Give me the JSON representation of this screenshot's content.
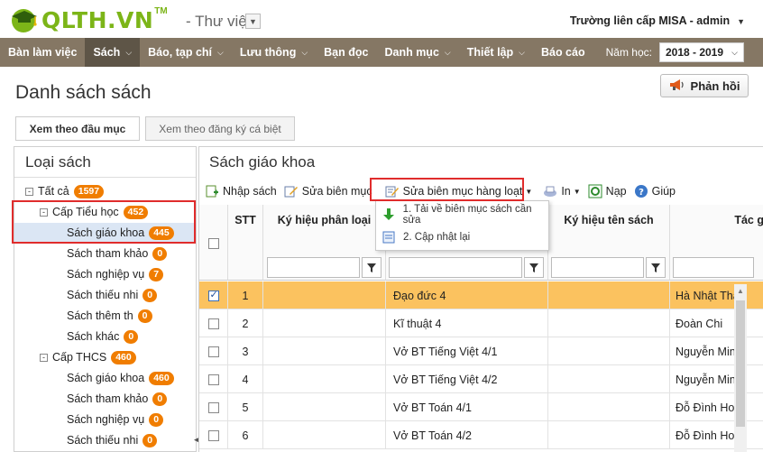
{
  "header": {
    "logo_text": "QLTH.VN",
    "logo_tm": "TM",
    "module": "- Thư viện",
    "school": "Trường liên cấp MISA - admin"
  },
  "nav": {
    "items": [
      {
        "label": "Bàn làm việc",
        "has_chevron": false
      },
      {
        "label": "Sách",
        "has_chevron": true
      },
      {
        "label": "Báo, tạp chí",
        "has_chevron": true
      },
      {
        "label": "Lưu thông",
        "has_chevron": true
      },
      {
        "label": "Bạn đọc",
        "has_chevron": false
      },
      {
        "label": "Danh mục",
        "has_chevron": true
      },
      {
        "label": "Thiết lập",
        "has_chevron": true
      },
      {
        "label": "Báo cáo",
        "has_chevron": false
      }
    ],
    "active_index": 1,
    "year_label": "Năm học:",
    "year_value": "2018 - 2019"
  },
  "page": {
    "title": "Danh sách sách",
    "feedback": "Phản hồi",
    "tab_by_title": "Xem theo đầu mục",
    "tab_by_register": "Xem theo đăng ký cá biệt"
  },
  "left": {
    "title": "Loại sách",
    "tree": [
      {
        "label": "Tất cả",
        "badge": "1597",
        "level": 0,
        "toggle": "-"
      },
      {
        "label": "Cấp Tiểu học",
        "badge": "452",
        "level": 1,
        "toggle": "-"
      },
      {
        "label": "Sách giáo khoa",
        "badge": "445",
        "level": 2,
        "selected": true
      },
      {
        "label": "Sách tham khảo",
        "badge": "0",
        "level": 2
      },
      {
        "label": "Sách nghiệp vụ",
        "badge": "7",
        "level": 2
      },
      {
        "label": "Sách thiếu nhi",
        "badge": "0",
        "level": 2
      },
      {
        "label": "Sách thêm th",
        "badge": "0",
        "level": 2
      },
      {
        "label": "Sách khác",
        "badge": "0",
        "level": 2
      },
      {
        "label": "Cấp THCS",
        "badge": "460",
        "level": 1,
        "toggle": "-"
      },
      {
        "label": "Sách giáo khoa",
        "badge": "460",
        "level": 2
      },
      {
        "label": "Sách tham khảo",
        "badge": "0",
        "level": 2
      },
      {
        "label": "Sách nghiệp vụ",
        "badge": "0",
        "level": 2
      },
      {
        "label": "Sách thiếu nhi",
        "badge": "0",
        "level": 2
      }
    ]
  },
  "right": {
    "title": "Sách giáo khoa",
    "toolbar": {
      "import": "Nhập sách",
      "edit": "Sửa biên mục",
      "bulk_edit": "Sửa biên mục hàng loạt",
      "print": "In",
      "load": "Nạp",
      "help": "Giúp"
    },
    "menu": [
      "1. Tải về biên mục sách cần sửa",
      "2. Cập nhật lại"
    ],
    "columns": {
      "stt": "STT",
      "classification": "Ký hiệu phân loại",
      "book_code": "Ký hiệu tên sách",
      "author": "Tác g"
    },
    "rows": [
      {
        "checked": true,
        "stt": "1",
        "title": "Đạo đức 4",
        "author": "Hà Nhật Thă"
      },
      {
        "checked": false,
        "stt": "2",
        "title": "Kĩ thuật 4",
        "author": "Đoàn Chi"
      },
      {
        "checked": false,
        "stt": "3",
        "title": "Vở BT Tiếng Việt 4/1",
        "author": "Nguyễn Min"
      },
      {
        "checked": false,
        "stt": "4",
        "title": "Vở BT Tiếng Việt 4/2",
        "author": "Nguyễn Min"
      },
      {
        "checked": false,
        "stt": "5",
        "title": "Vở BT Toán 4/1",
        "author": "Đỗ Đình Ho"
      },
      {
        "checked": false,
        "stt": "6",
        "title": "Vở BT Toán 4/2",
        "author": "Đỗ Đình Ho"
      }
    ]
  },
  "colors": {
    "nav_bg": "#857764",
    "nav_active": "#5e5547",
    "logo_green": "#7cb518",
    "badge_orange": "#f07d00",
    "selected_row": "#fbc25f",
    "highlight_red": "#e02c2c"
  }
}
